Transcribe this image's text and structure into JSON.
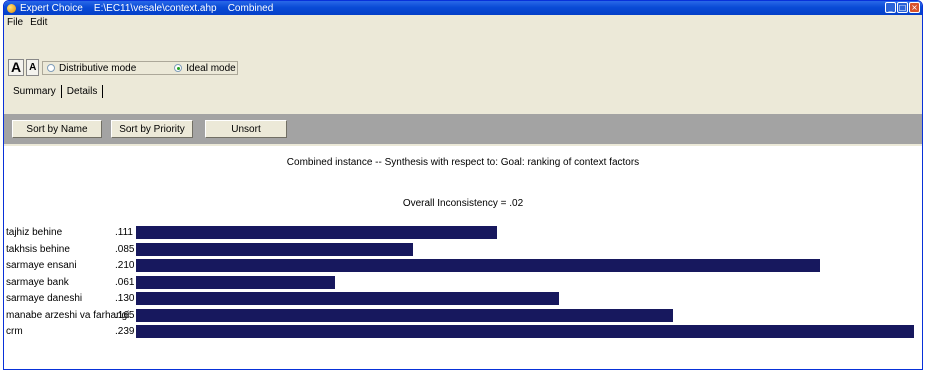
{
  "window": {
    "title": "Expert Choice    E:\\EC11\\vesale\\context.ahp    Combined",
    "minimize": "_",
    "maximize": "□",
    "close": "×"
  },
  "menu": {
    "items": [
      "File",
      "Edit"
    ]
  },
  "font_controls": {
    "larger": "A",
    "smaller": "A"
  },
  "modes": {
    "distributive": {
      "label": "Distributive mode",
      "selected": false
    },
    "ideal": {
      "label": "Ideal mode",
      "selected": true
    }
  },
  "tabs": [
    "Summary",
    "Details"
  ],
  "sort_buttons": [
    "Sort by Name",
    "Sort by Priority",
    "Unsort"
  ],
  "synthesis": {
    "heading": "Combined instance -- Synthesis with respect to: Goal: ranking of context factors",
    "inconsistency": "Overall Inconsistency = .02"
  },
  "colors": {
    "bar": "#17185e",
    "sort_bar": "#a3a3a3",
    "chrome": "#ece9d8"
  },
  "chart_data": {
    "type": "bar",
    "orientation": "horizontal",
    "categories": [
      "tajhiz behine",
      "takhsis behine",
      "sarmaye ensani",
      "sarmaye bank",
      "sarmaye daneshi",
      "manabe arzeshi va farhangi",
      "crm"
    ],
    "value_labels": [
      ".111",
      ".085",
      ".210",
      ".061",
      ".130",
      ".165",
      ".239"
    ],
    "values": [
      0.111,
      0.085,
      0.21,
      0.061,
      0.13,
      0.165,
      0.239
    ],
    "xlim": [
      0,
      0.239
    ]
  }
}
